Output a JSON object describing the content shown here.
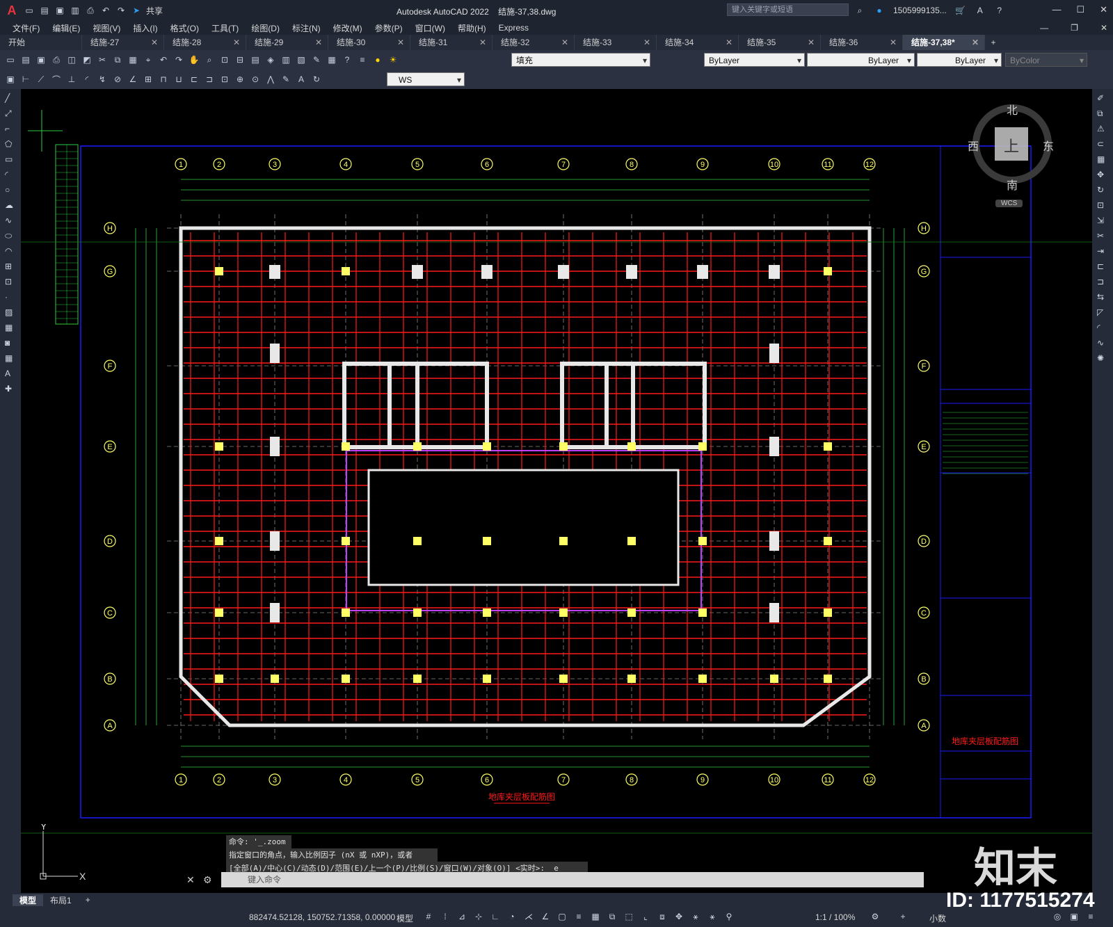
{
  "title_bar": {
    "share_label": "共享",
    "app_title": "Autodesk AutoCAD 2022",
    "file_name": "结施-37,38.dwg",
    "search_placeholder": "键入关键字或短语",
    "username": "1505999135..."
  },
  "menu": [
    "文件(F)",
    "编辑(E)",
    "视图(V)",
    "插入(I)",
    "格式(O)",
    "工具(T)",
    "绘图(D)",
    "标注(N)",
    "修改(M)",
    "参数(P)",
    "窗口(W)",
    "帮助(H)",
    "Express"
  ],
  "doc_tabs": [
    {
      "label": "开始"
    },
    {
      "label": "结施-27"
    },
    {
      "label": "结施-28"
    },
    {
      "label": "结施-29"
    },
    {
      "label": "结施-30"
    },
    {
      "label": "结施-31"
    },
    {
      "label": "结施-32"
    },
    {
      "label": "结施-33"
    },
    {
      "label": "结施-34"
    },
    {
      "label": "结施-35"
    },
    {
      "label": "结施-36"
    },
    {
      "label": "结施-37,38*"
    }
  ],
  "toolbar": {
    "layer_name": "填充",
    "color": "ByLayer",
    "linetype": "ByLayer",
    "lineweight": "ByLayer",
    "plotstyle": "ByColor",
    "workspace": "WS"
  },
  "viewcube": {
    "north": "北",
    "south": "南",
    "east": "东",
    "west": "西",
    "top": "上",
    "ucs": "WCS"
  },
  "drawing": {
    "grid_cols": [
      "1",
      "2",
      "3",
      "4",
      "5",
      "6",
      "7",
      "8",
      "9",
      "10",
      "11",
      "12"
    ],
    "grid_rows": [
      "H",
      "G",
      "F",
      "E",
      "D",
      "C",
      "B",
      "A"
    ],
    "plan_title": "地库夹层板配筋图",
    "sheet_title": "地库夹层板配筋图"
  },
  "command": {
    "history": [
      "命令: '_.zoom",
      "指定窗口的角点，输入比例因子 (nX 或 nXP)，或者",
      "[全部(A)/中心(C)/动态(D)/范围(E)/上一个(P)/比例(S)/窗口(W)/对象(O)] <实时>: _e"
    ],
    "input_placeholder": "键入命令"
  },
  "layout_tabs": [
    "模型",
    "布局1"
  ],
  "status": {
    "coords": "882474.52128, 150752.71358, 0.00000",
    "model": "模型",
    "scale": "1:1 / 100%",
    "units": "小数"
  },
  "watermark": {
    "logo": "知末",
    "id": "ID: 1177515274"
  },
  "colors": {
    "rebar": "#ff1a1a",
    "grid": "#2ecc40",
    "wall": "#e8e8e8",
    "column": "#ffff66",
    "frame": "#1a1aff",
    "accent": "#e8343a"
  }
}
